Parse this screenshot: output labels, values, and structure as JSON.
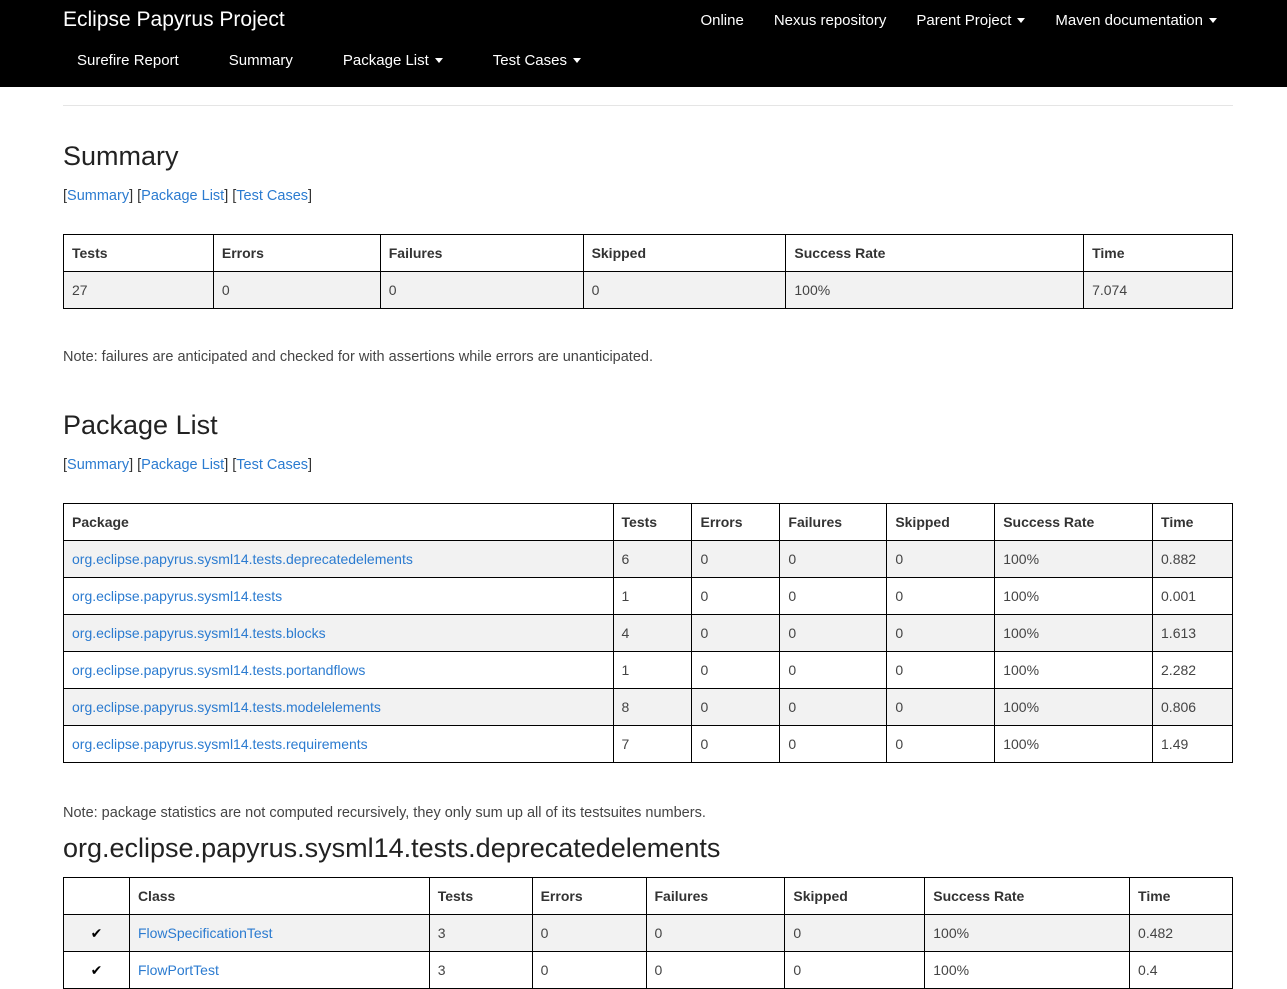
{
  "navbar": {
    "brand": "Eclipse Papyrus Project",
    "top_items": [
      {
        "label": "Online",
        "dropdown": false
      },
      {
        "label": "Nexus repository",
        "dropdown": false
      },
      {
        "label": "Parent Project",
        "dropdown": true
      },
      {
        "label": "Maven documentation",
        "dropdown": true
      }
    ],
    "sub_items": [
      {
        "label": "Surefire Report",
        "dropdown": false
      },
      {
        "label": "Summary",
        "dropdown": false
      },
      {
        "label": "Package List",
        "dropdown": true
      },
      {
        "label": "Test Cases",
        "dropdown": true
      }
    ]
  },
  "section_links": {
    "summary": "Summary",
    "package_list": "Package List",
    "test_cases": "Test Cases"
  },
  "summary": {
    "title": "Summary",
    "headers": [
      "Tests",
      "Errors",
      "Failures",
      "Skipped",
      "Success Rate",
      "Time"
    ],
    "row": [
      "27",
      "0",
      "0",
      "0",
      "100%",
      "7.074"
    ],
    "note": "Note: failures are anticipated and checked for with assertions while errors are unanticipated."
  },
  "package_list": {
    "title": "Package List",
    "headers": [
      "Package",
      "Tests",
      "Errors",
      "Failures",
      "Skipped",
      "Success Rate",
      "Time"
    ],
    "rows": [
      [
        "org.eclipse.papyrus.sysml14.tests.deprecatedelements",
        "6",
        "0",
        "0",
        "0",
        "100%",
        "0.882"
      ],
      [
        "org.eclipse.papyrus.sysml14.tests",
        "1",
        "0",
        "0",
        "0",
        "100%",
        "0.001"
      ],
      [
        "org.eclipse.papyrus.sysml14.tests.blocks",
        "4",
        "0",
        "0",
        "0",
        "100%",
        "1.613"
      ],
      [
        "org.eclipse.papyrus.sysml14.tests.portandflows",
        "1",
        "0",
        "0",
        "0",
        "100%",
        "2.282"
      ],
      [
        "org.eclipse.papyrus.sysml14.tests.modelelements",
        "8",
        "0",
        "0",
        "0",
        "100%",
        "0.806"
      ],
      [
        "org.eclipse.papyrus.sysml14.tests.requirements",
        "7",
        "0",
        "0",
        "0",
        "100%",
        "1.49"
      ]
    ],
    "note": "Note: package statistics are not computed recursively, they only sum up all of its testsuites numbers."
  },
  "package_detail": {
    "title": "org.eclipse.papyrus.sysml14.tests.deprecatedelements",
    "headers": [
      "",
      "Class",
      "Tests",
      "Errors",
      "Failures",
      "Skipped",
      "Success Rate",
      "Time"
    ],
    "rows": [
      {
        "status": "✔",
        "cells": [
          "FlowSpecificationTest",
          "3",
          "0",
          "0",
          "0",
          "100%",
          "0.482"
        ]
      },
      {
        "status": "✔",
        "cells": [
          "FlowPortTest",
          "3",
          "0",
          "0",
          "0",
          "100%",
          "0.4"
        ]
      }
    ]
  }
}
